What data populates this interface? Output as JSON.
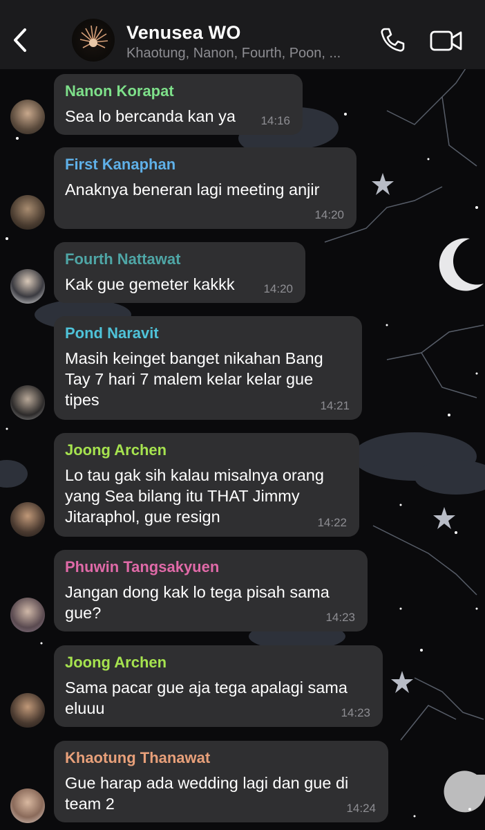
{
  "header": {
    "title": "Venusea WO",
    "members": "Khaotung, Nanon, Fourth, Poon, ..."
  },
  "colors": {
    "header_bg": "#1b1b1d",
    "bubble_bg": "#2f2f31",
    "time": "#8e8e93"
  },
  "messages": [
    {
      "sender": "Nanon Korapat",
      "text": "Sea lo bercanda kan ya",
      "time": "14:16",
      "color": "#7ee08a"
    },
    {
      "sender": "First Kanaphan",
      "text": "Anaknya beneran lagi meeting anjir",
      "time": "14:20",
      "color": "#5fb0e8"
    },
    {
      "sender": "Fourth Nattawat",
      "text": "Kak gue gemeter kakkk",
      "time": "14:20",
      "color": "#4fa6a6"
    },
    {
      "sender": "Pond Naravit",
      "text": "Masih keinget banget nikahan Bang Tay 7 hari 7 malem kelar kelar gue tipes",
      "time": "14:21",
      "color": "#4fc3d9"
    },
    {
      "sender": "Joong Archen",
      "text": "Lo tau gak sih kalau misalnya orang yang Sea bilang itu THAT Jimmy Jitaraphol, gue resign",
      "time": "14:22",
      "color": "#a6e34f"
    },
    {
      "sender": "Phuwin Tangsakyuen",
      "text": "Jangan dong kak lo tega pisah sama gue?",
      "time": "14:23",
      "color": "#e06aa8"
    },
    {
      "sender": "Joong Archen",
      "text": "Sama pacar gue aja tega apalagi sama eluuu",
      "time": "14:23",
      "color": "#a6e34f"
    },
    {
      "sender": "Khaotung Thanawat",
      "text": "Gue harap ada wedding lagi dan gue di team 2",
      "time": "14:24",
      "color": "#e8a07a"
    }
  ]
}
